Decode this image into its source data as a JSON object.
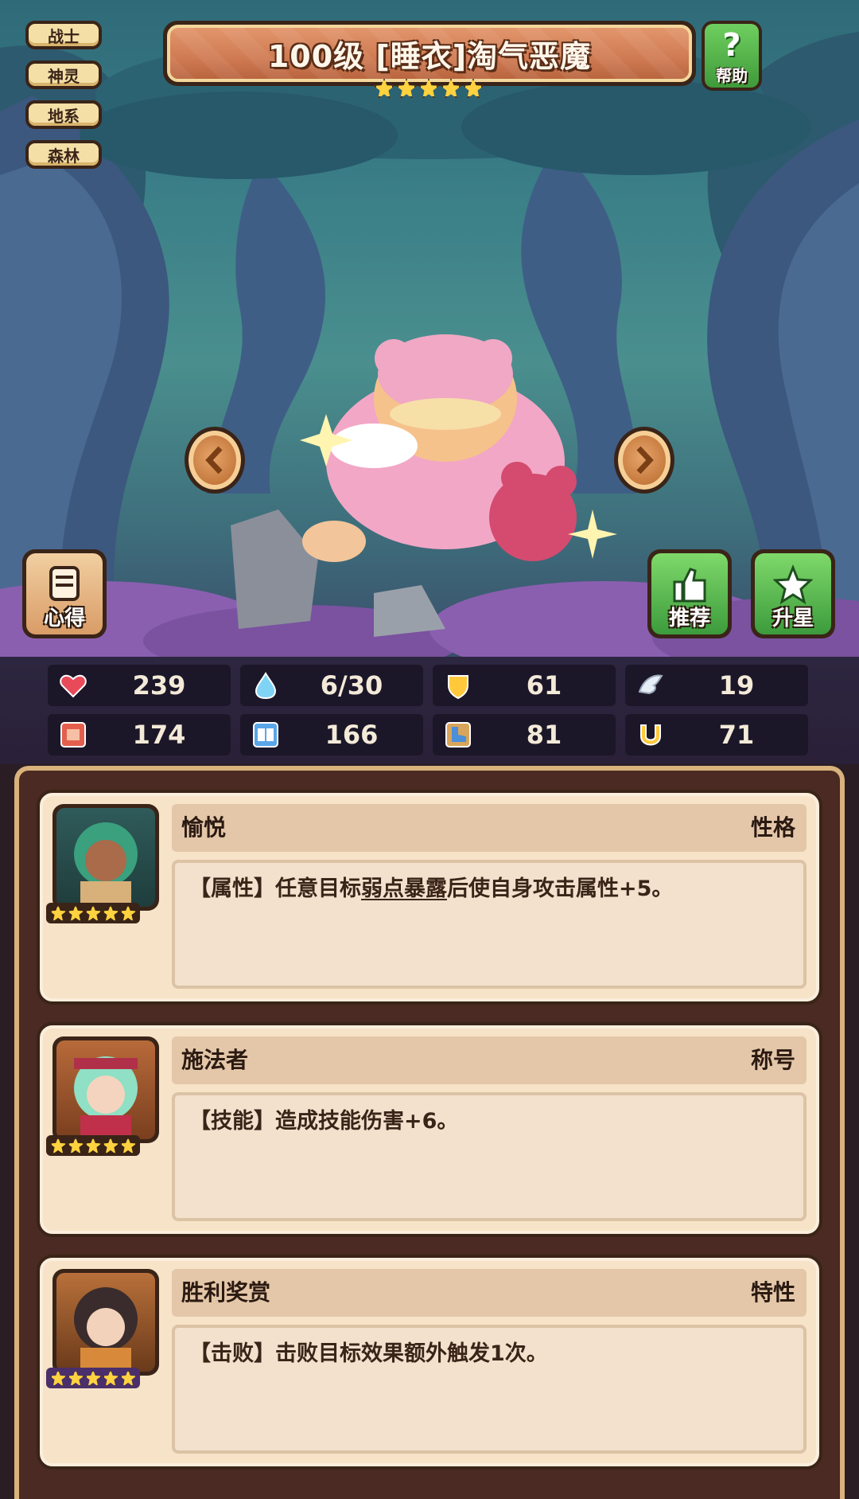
{
  "header": {
    "title": "100级 [睡衣]淘气恶魔",
    "star_count": 5,
    "help_label": "帮助",
    "help_symbol": "?"
  },
  "tags": [
    "战士",
    "神灵",
    "地系",
    "森林"
  ],
  "actions": {
    "notes_label": "心得",
    "recommend_label": "推荐",
    "star_up_label": "升星"
  },
  "stats": [
    {
      "icon": "heart-icon",
      "value": "239"
    },
    {
      "icon": "water-drop-icon",
      "value": "6/30"
    },
    {
      "icon": "shield-icon",
      "value": "61"
    },
    {
      "icon": "wing-icon",
      "value": "19"
    },
    {
      "icon": "fist-icon",
      "value": "174"
    },
    {
      "icon": "book-icon",
      "value": "166"
    },
    {
      "icon": "boot-icon",
      "value": "81"
    },
    {
      "icon": "horseshoe-icon",
      "value": "71"
    }
  ],
  "cards": [
    {
      "name": "愉悦",
      "type": "性格",
      "desc_prefix": "【属性】任意目标",
      "desc_link": "弱点暴露",
      "desc_suffix": "后使自身攻击属性+5。",
      "stars": 5
    },
    {
      "name": "施法者",
      "type": "称号",
      "desc": "【技能】造成技能伤害+6。",
      "stars": 5
    },
    {
      "name": "胜利奖赏",
      "type": "特性",
      "desc": "【击败】击败目标效果额外触发1次。",
      "stars": 5
    }
  ],
  "colors": {
    "outline": "#3a2418",
    "tag_bg": "#f4dfa6",
    "title_bar": "#cf7a52",
    "green_button": "#3f9a3a",
    "card_bg": "#f7e3c7",
    "star": "#ffd23f"
  }
}
